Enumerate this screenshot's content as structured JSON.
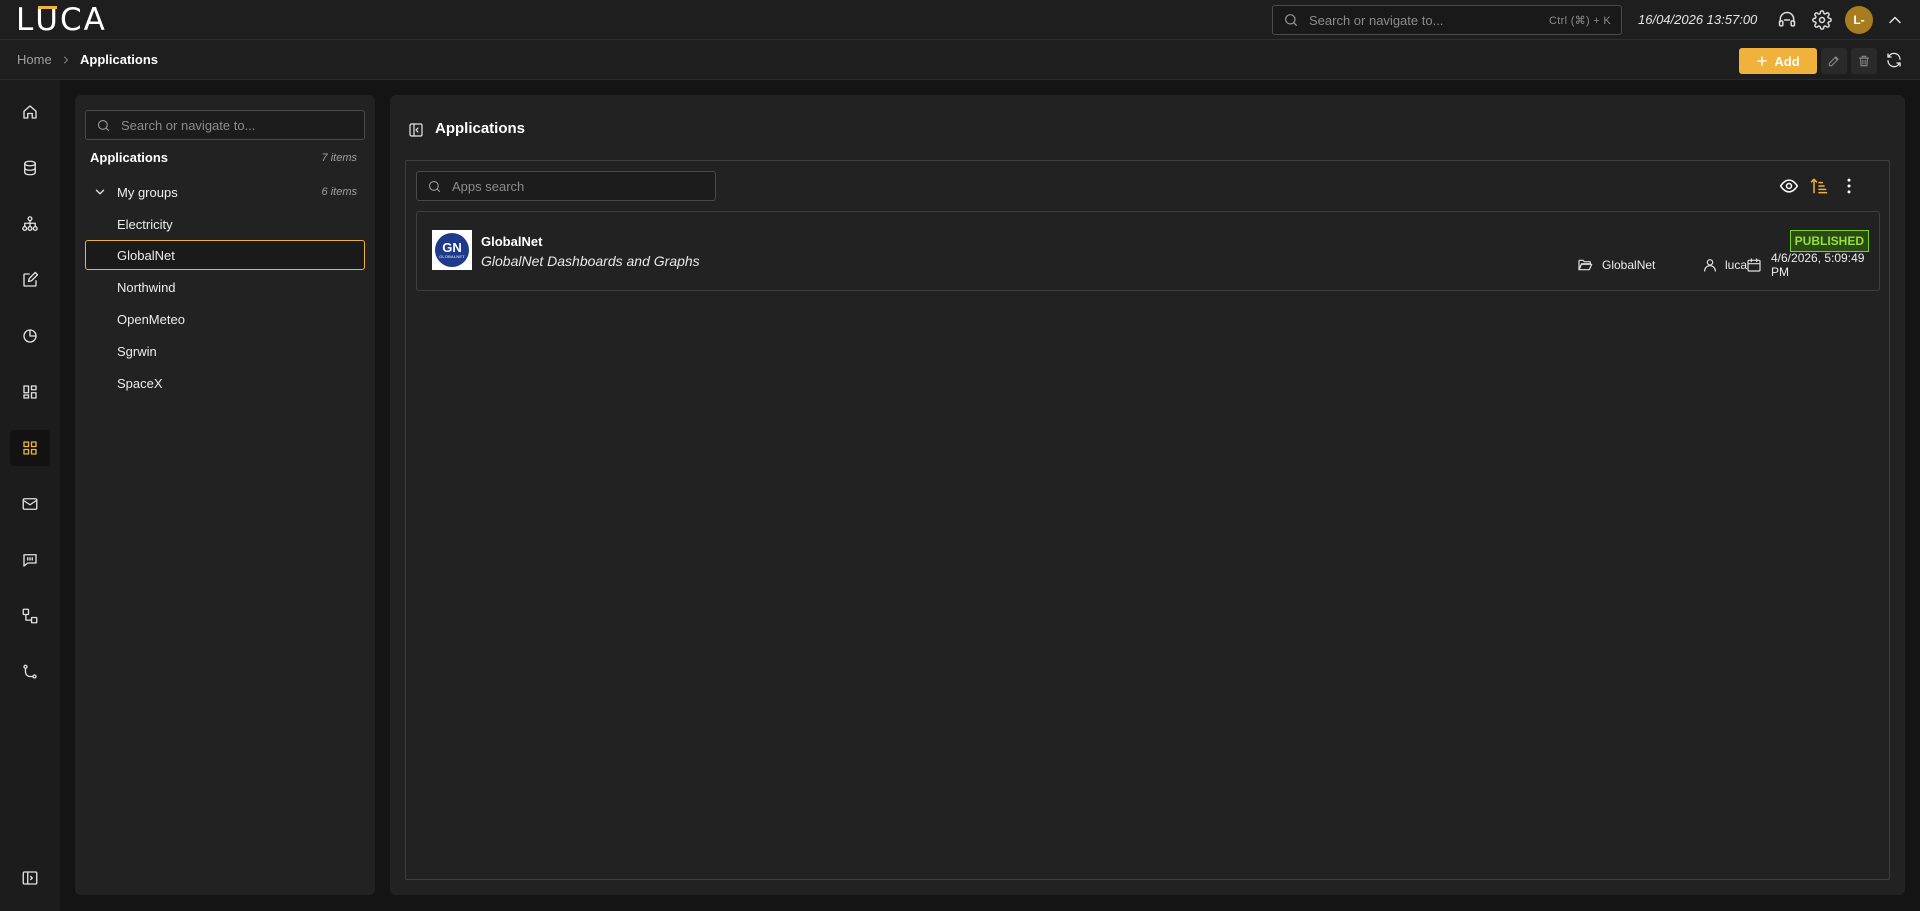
{
  "app": {
    "logo_text_l": "L",
    "logo_text_u": "U",
    "logo_text_ca": "CA"
  },
  "topbar": {
    "search_placeholder": "Search or navigate to...",
    "search_shortcut": "Ctrl (⌘) + K",
    "datetime": "16/04/2026 13:57:00",
    "avatar_initials": "L-",
    "icons": [
      "support-icon",
      "gear-icon",
      "chevron-up-icon"
    ]
  },
  "breadcrumb": {
    "home": "Home",
    "current": "Applications"
  },
  "actions": {
    "add_label": "Add"
  },
  "rail": {
    "items": [
      "home-icon",
      "database-icon",
      "network-icon",
      "edit-icon",
      "pie-chart-icon",
      "dashboard-icon",
      "apps-icon",
      "mail-icon",
      "chat-icon",
      "workflow-icon",
      "git-branch-icon"
    ],
    "active": "apps-icon"
  },
  "sidepanel": {
    "search_placeholder": "Search or navigate to...",
    "title": "Applications",
    "count": "7 items",
    "group": {
      "label": "My groups",
      "count": "6 items"
    },
    "items": [
      {
        "label": "Electricity"
      },
      {
        "label": "GlobalNet"
      },
      {
        "label": "Northwind"
      },
      {
        "label": "OpenMeteo"
      },
      {
        "label": "Sgrwin"
      },
      {
        "label": "SpaceX"
      }
    ],
    "selected_index": 1
  },
  "main": {
    "title": "Applications",
    "apps_search_placeholder": "Apps search",
    "apps": [
      {
        "name": "GlobalNet",
        "description": "GlobalNet Dashboards and Graphs",
        "status": "PUBLISHED",
        "group": "GlobalNet",
        "owner": "luca",
        "date": "4/6/2026, 5:09:49 PM",
        "logo_initials": "GN",
        "logo_subtext": "GLOBALNET"
      }
    ]
  },
  "colors": {
    "accent": "#f0b23a",
    "published": "#7ed321",
    "background": "#141414",
    "panel": "#222222"
  }
}
